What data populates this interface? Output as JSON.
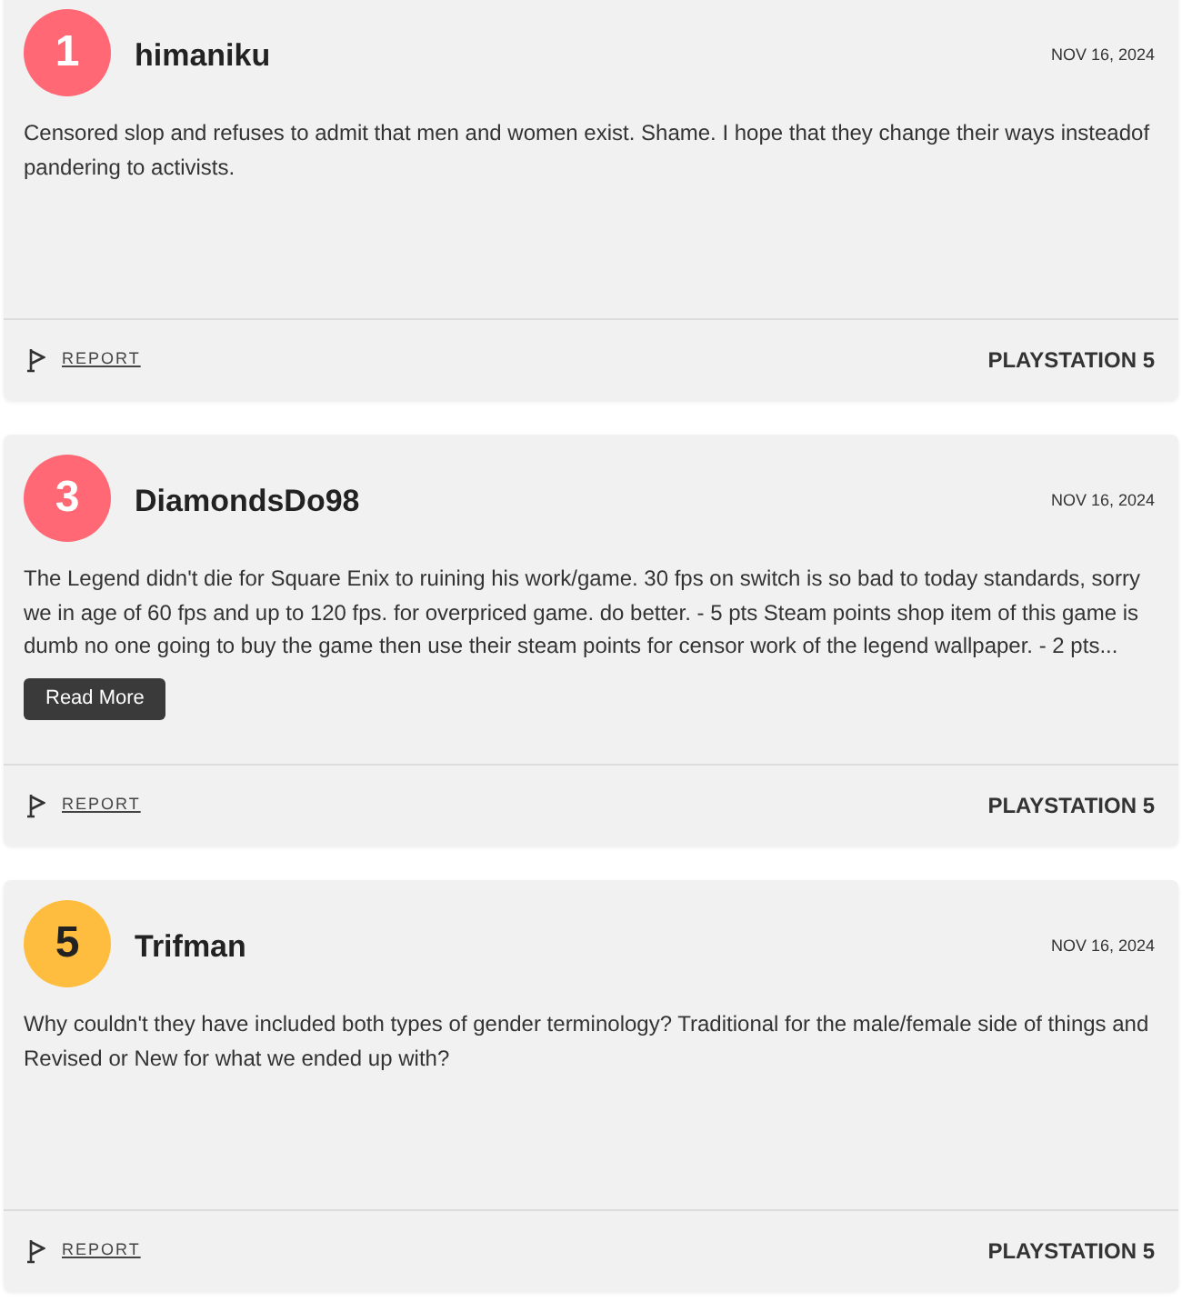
{
  "reviews": [
    {
      "score": "1",
      "color": "#ff6874",
      "author": "himaniku",
      "date": "NOV 16, 2024",
      "text": "Censored slop and refuses to admit that men and women exist. Shame. I hope that they change their ways insteadof pandering to activists.",
      "report": "REPORT",
      "platform": "PLAYSTATION 5"
    },
    {
      "score": "3",
      "color": "#ff6874",
      "author": "DiamondsDo98",
      "date": "NOV 16, 2024",
      "text": "The Legend didn't die for Square Enix to ruining his work/game. 30 fps on switch is so bad to today standards, sorry we in age of 60 fps and up to 120 fps. for overpriced game. do better. - 5 pts Steam points shop item of this game is dumb no one going to buy the game then use their steam points for censor work of the legend wallpaper. - 2 pts...",
      "read_more": "Read More",
      "report": "REPORT",
      "platform": "PLAYSTATION 5"
    },
    {
      "score": "5",
      "color": "#ffbd3f",
      "author": "Trifman",
      "date": "NOV 16, 2024",
      "text": "Why couldn't they have included both types of gender terminology? Traditional for the male/female side of things and Revised or New for what we ended up with?",
      "report": "REPORT",
      "platform": "PLAYSTATION 5"
    }
  ]
}
